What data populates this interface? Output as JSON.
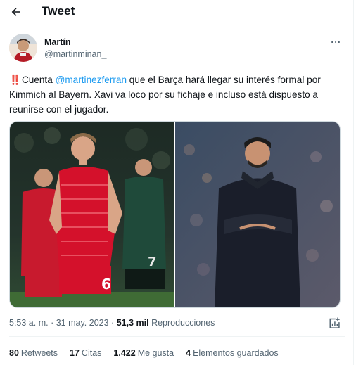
{
  "header": {
    "title": "Tweet"
  },
  "author": {
    "name": "Martín",
    "handle": "@martinminan_"
  },
  "tweet": {
    "emoji": "‼️",
    "text_before_mention": "Cuenta ",
    "mention": "@martinezferran",
    "text_after_mention": " que el Barça hará llegar su interés formal por",
    "line2": "Kimmich al Bayern. Xavi va loco por su fichaje e incluso está dispuesto a",
    "line3": "reunirse con el jugador."
  },
  "media": {
    "left_shirt_number": "6",
    "right_shirt_number": "7"
  },
  "meta": {
    "time": "5:53 a. m.",
    "separator": "·",
    "date": "31 may. 2023",
    "views_count": "51,3 mil",
    "views_label": "Reproducciones"
  },
  "stats": [
    {
      "count": "80",
      "label": "Retweets"
    },
    {
      "count": "17",
      "label": "Citas"
    },
    {
      "count": "1.422",
      "label": "Me gusta"
    },
    {
      "count": "4",
      "label": "Elementos guardados"
    }
  ],
  "colors": {
    "text": "#0f1419",
    "secondary": "#536471",
    "link": "#1d9bf0",
    "bayern_red": "#d4112b"
  }
}
